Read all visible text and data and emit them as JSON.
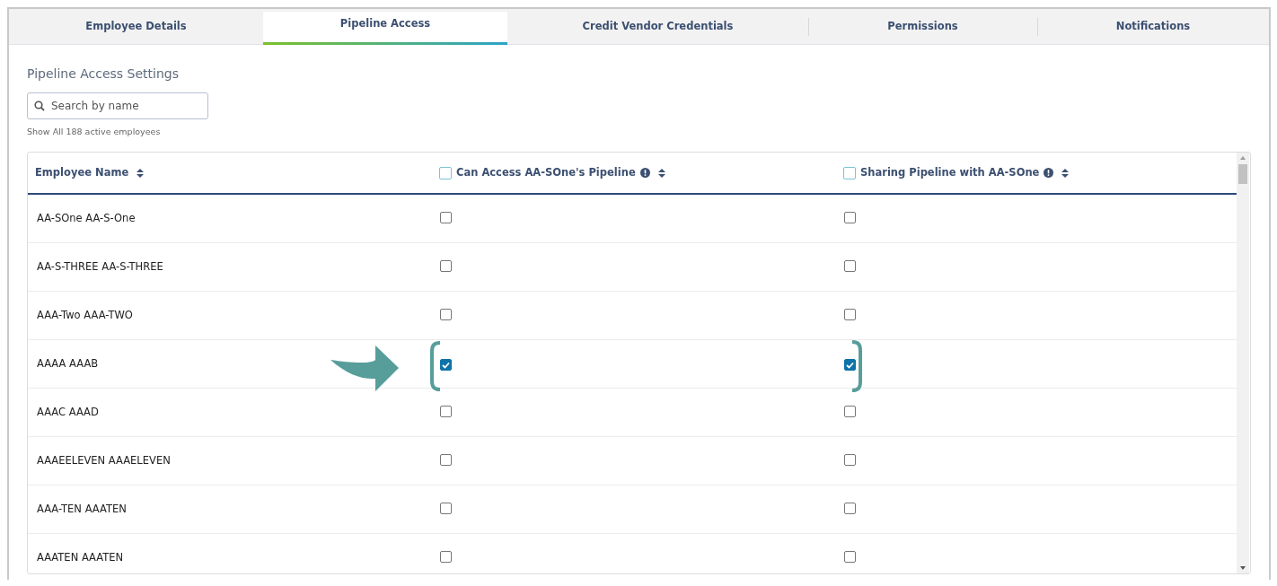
{
  "tabs": [
    {
      "label": "Employee Details",
      "selected": false
    },
    {
      "label": "Pipeline Access",
      "selected": true
    },
    {
      "label": "Credit Vendor Credentials",
      "selected": false
    },
    {
      "label": "Permissions",
      "selected": false
    },
    {
      "label": "Notifications",
      "selected": false
    }
  ],
  "section_title": "Pipeline Access Settings",
  "search": {
    "placeholder": "Search by name"
  },
  "show_all_link": "Show All 188 active employees",
  "table": {
    "columns": [
      {
        "label": "Employee Name",
        "kind": "text"
      },
      {
        "label": "Can Access AA-SOne's Pipeline",
        "kind": "checkbox",
        "checked": false
      },
      {
        "label": "Sharing Pipeline with AA-SOne",
        "kind": "checkbox",
        "checked": false
      }
    ],
    "rows": [
      {
        "name": "AA-SOne AA-S-One",
        "can_access": false,
        "sharing": false
      },
      {
        "name": "AA-S-THREE AA-S-THREE",
        "can_access": false,
        "sharing": false
      },
      {
        "name": "AAA-Two AAA-TWO",
        "can_access": false,
        "sharing": false
      },
      {
        "name": "AAAA AAAB",
        "can_access": true,
        "sharing": true
      },
      {
        "name": "AAAC AAAD",
        "can_access": false,
        "sharing": false
      },
      {
        "name": "AAAEELEVEN AAAELEVEN",
        "can_access": false,
        "sharing": false
      },
      {
        "name": "AAA-TEN AAATEN",
        "can_access": false,
        "sharing": false
      },
      {
        "name": "AAATEN AAATEN",
        "can_access": false,
        "sharing": false
      }
    ]
  }
}
